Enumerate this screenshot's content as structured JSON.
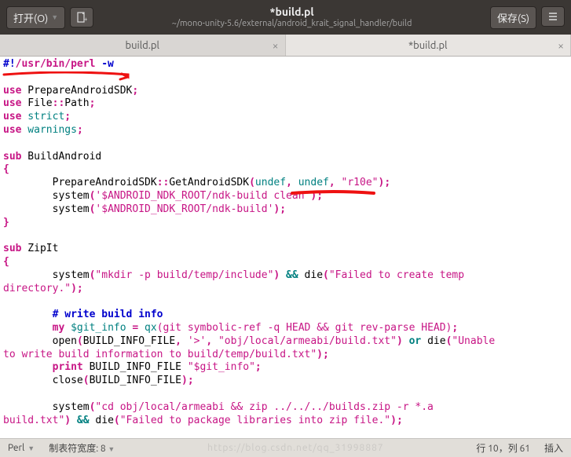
{
  "titlebar": {
    "open_label": "打开(O)",
    "title": "*build.pl",
    "path": "~/mono-unity-5.6/external/android_krait_signal_handler/build",
    "save_label": "保存(S)"
  },
  "tabs": [
    {
      "label": "build.pl",
      "close": "×"
    },
    {
      "label": "*build.pl",
      "close": "×"
    }
  ],
  "code": {
    "she1": "#!",
    "she2": "/usr/bin/perl",
    "sheflag": " -w",
    "l2": "",
    "use": "use",
    "m1": " PrepareAndroidSDK",
    "semi": ";",
    "m2": " File",
    "dcolon": "::",
    "m2b": "Path",
    "m3": " strict",
    "m4": " warnings",
    "sub": "sub",
    "fn1": " BuildAndroid",
    "ob": "{",
    "cb": "}",
    "ind": "        ",
    "call1a": "PrepareAndroidSDK",
    "call1b": "GetAndroidSDK",
    "lp": "(",
    "rp": ")",
    "undef": "undef",
    "comma": ", ",
    "str_r10e": "\"r10e\"",
    "syswd": "system",
    "str_ndk1": "'$ANDROID_NDK_ROOT/ndk-build clean'",
    "str_ndk2": "'$ANDROID_NDK_ROOT/ndk-build'",
    "fn2": " ZipIt",
    "str_mkdir": "\"mkdir -p build/temp/include\"",
    "andand": " && ",
    "die": "die",
    "str_fail1a": "\"Failed to create temp ",
    "str_fail1b": "directory.\"",
    "cmt1": "# write build info",
    "my": "my",
    "gitvar": " $git_info",
    "eq": " = ",
    "qx": "qx",
    "qxbody": "(git symbolic-ref -q HEAD && git rev-parse HEAD)",
    "open": "open",
    "bif": "BUILD_INFO_FILE",
    "gt": "'>'",
    "str_objp": "\"obj/local/armeabi/build.txt\"",
    "or": " or ",
    "str_fail2a": "\"Unable ",
    "str_fail2b": "to write build information to build/temp/build.txt\"",
    "print": "print",
    "printarg": " BUILD_INFO_FILE ",
    "str_git": "\"$git_info\"",
    "close": "close",
    "str_cd": "\"cd obj/local/armeabi && zip ../../../builds.zip -r *.a ",
    "str_cd2": "build.txt\"",
    "str_fail3": "\"Failed to package libraries into zip file.\""
  },
  "statusbar": {
    "lang": "Perl",
    "tab_width": "制表符宽度: 8",
    "position": "行 10，列 61",
    "mode": "插入",
    "watermark": "https://blog.csdn.net/qq_31998887"
  }
}
